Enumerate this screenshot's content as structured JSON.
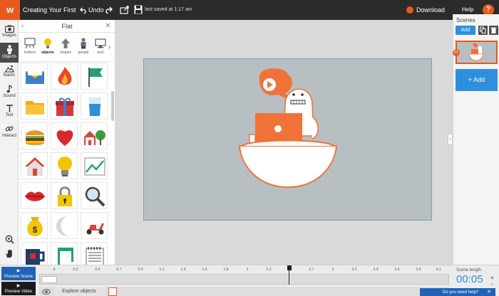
{
  "app": {
    "logo_text": "w",
    "doc_title": "Creating Your First W...",
    "undo_label": "Undo",
    "saved_status": "last saved at 1:17 am",
    "download_label": "Download",
    "help_label": "Help",
    "help_icon": "?"
  },
  "toolstrip": {
    "items": [
      {
        "label": "Images",
        "icon": "camera-icon"
      },
      {
        "label": "Objects",
        "icon": "person-icon",
        "active": true
      },
      {
        "label": "Backs",
        "icon": "landscape-icon"
      },
      {
        "label": "Sound",
        "icon": "music-note-icon"
      },
      {
        "label": "Text",
        "icon": "text-t-icon"
      },
      {
        "label": "Interact",
        "icon": "link-icon"
      }
    ],
    "bottom": [
      "zoom-icon",
      "hand-icon"
    ]
  },
  "library": {
    "title": "Flat",
    "back": "‹",
    "close": "✕",
    "categories": [
      {
        "label": "holders",
        "icon": "easel-icon"
      },
      {
        "label": "objects",
        "icon": "lightbulb-icon"
      },
      {
        "label": "shapes",
        "icon": "arrow-up-icon"
      },
      {
        "label": "people",
        "icon": "person-icon"
      },
      {
        "label": "tech",
        "icon": "monitor-icon"
      }
    ],
    "next": "›",
    "assets": [
      "envelope-icon",
      "flame-icon",
      "flag-icon",
      "folder-icon",
      "gift-icon",
      "glass-of-water-icon",
      "hamburger-icon",
      "heart-icon",
      "houses-with-tree-icon",
      "house-icon",
      "light-bulb-icon",
      "line-chart-icon",
      "lips-icon",
      "padlock-icon",
      "magnifier-icon",
      "money-bag-icon",
      "moon-icon",
      "scooter-icon",
      "mug-icon",
      "music-notes-icon",
      "notepad-icon"
    ]
  },
  "scenes": {
    "title": "Scenes",
    "add_label": "Add",
    "scene_number": "01",
    "add_scene_label": "+ Add"
  },
  "timeline": {
    "preview_scene": "Preview Scene",
    "preview_video": "Preview Video",
    "ticks": [
      "0",
      "0.2",
      "0.5",
      "0.7",
      "0.9",
      "1.1",
      "1.4",
      "1.6",
      "1.8",
      "2",
      "2.3",
      "",
      "2.7",
      "3",
      "3.2",
      "3.4",
      "3.6",
      "3.9",
      "4.1"
    ],
    "explore_label": "Explore objects",
    "scene_length_label": "Scene length",
    "scene_length_value": "00:05",
    "plus": "+",
    "minus": "-",
    "help_bar": "Do you need help?",
    "help_bar_close": "✕"
  },
  "colors": {
    "accent": "#e8591e",
    "blue": "#2f8fde",
    "dark": "#2b2b2b",
    "canvas": "#b8bfc3"
  }
}
